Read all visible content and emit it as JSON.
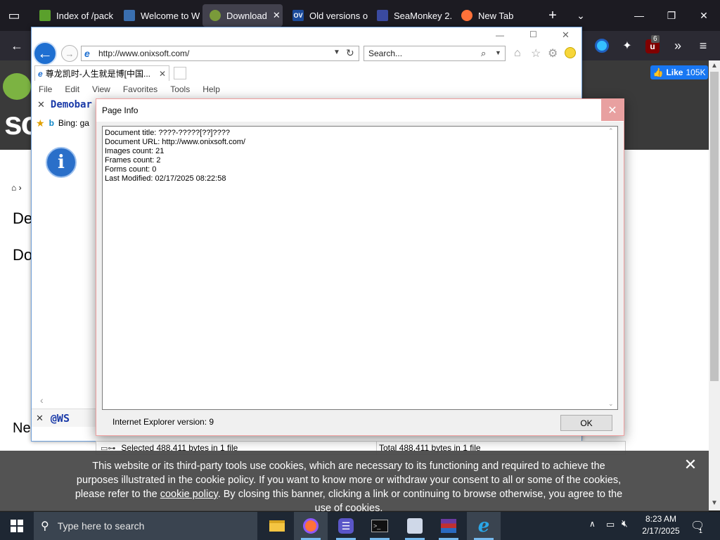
{
  "firefox": {
    "tabs": [
      {
        "label": "Index of /pack",
        "icon_color": "#5aa02c"
      },
      {
        "label": "Welcome to W",
        "icon_color": "#3a6fb0"
      },
      {
        "label": "Download",
        "icon_color": "#7a9a3a",
        "active": true
      },
      {
        "label": "Old versions o",
        "icon_color": "#1a4a9a"
      },
      {
        "label": "SeaMonkey 2.",
        "icon_color": "#3a4aa0"
      },
      {
        "label": "New Tab",
        "icon_color": "#ff7139"
      }
    ],
    "extension_badge": "6",
    "fb_like_label": "Like",
    "fb_like_count": "105K"
  },
  "ie": {
    "address": "http://www.onixsoft.com/",
    "search_placeholder": "Search...",
    "tab_label": "尊龙凯时-人生就是博[中国...",
    "menu": [
      "File",
      "Edit",
      "View",
      "Favorites",
      "Tools",
      "Help"
    ],
    "demobar_label": "Demobar",
    "bing_label": "Bing: ga",
    "bottom_label": "@WS"
  },
  "explorer_status": {
    "selected": "Selected 488,411 bytes in 1 file",
    "total": "Total 488,411 bytes in 1 file"
  },
  "dialog": {
    "title": "Page Info",
    "lines": [
      "Document title: ????-?????[??]????",
      "Document URL: http://www.onixsoft.com/",
      "Images count: 21",
      "Frames count: 2",
      "Forms count: 0",
      "Last Modified: 02/17/2025 08:22:58"
    ],
    "footer": "Internet Explorer version: 9",
    "ok_label": "OK"
  },
  "cookie": {
    "text_before": "This website or its third-party tools use cookies, which are necessary to its functioning and required to achieve the purposes illustrated in the cookie policy. If you want to know more or withdraw your consent to all or some of the cookies, please refer to the ",
    "link": "cookie policy",
    "text_after": ". By closing this banner, clicking a link or continuing to browse otherwise, you agree to the use of cookies."
  },
  "taskbar": {
    "search_placeholder": "Type here to search",
    "time": "8:23 AM",
    "date": "2/17/2025",
    "notification_count": "1"
  },
  "colors": {
    "ie_accent": "#1e6fd1",
    "taskbar": "#1e2733",
    "firefox_tabbar": "#1c1b22"
  }
}
